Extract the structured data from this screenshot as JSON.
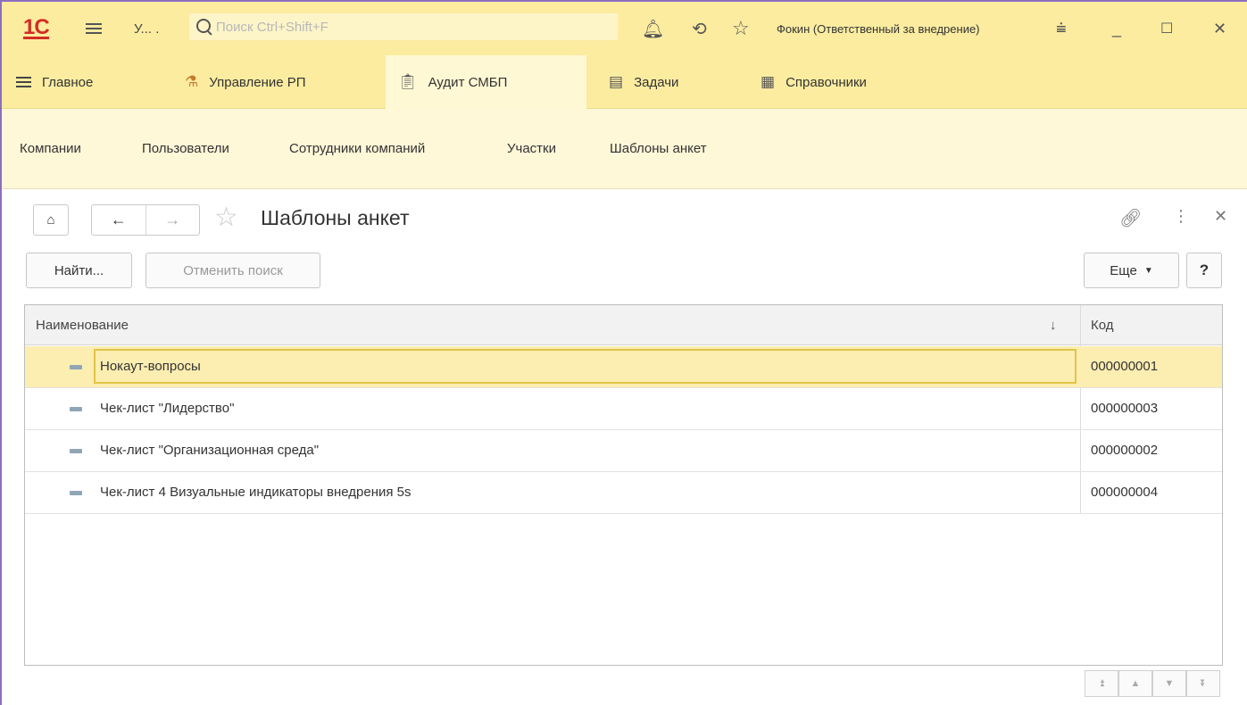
{
  "titlebar": {
    "logo": "1С",
    "app_name": "У... .",
    "search_placeholder": "Поиск Ctrl+Shift+F",
    "user": "Фокин (Ответственный за внедрение)"
  },
  "sections": [
    {
      "label": "Главное",
      "icon": "menu-icon"
    },
    {
      "label": "Управление РП",
      "icon": "workflow-icon"
    },
    {
      "label": "Аудит СМБП",
      "icon": "clipboard-icon",
      "active": true
    },
    {
      "label": "Задачи",
      "icon": "document-icon"
    },
    {
      "label": "Справочники",
      "icon": "table-icon"
    }
  ],
  "functions": [
    "Компании",
    "Пользователи",
    "Сотрудники компаний",
    "Участки",
    "Шаблоны анкет"
  ],
  "form": {
    "title": "Шаблоны анкет"
  },
  "commands": {
    "find": "Найти...",
    "cancel_search": "Отменить поиск",
    "more": "Еще",
    "help": "?"
  },
  "table": {
    "columns": {
      "name": "Наименование",
      "code": "Код"
    },
    "sort_indicator": "↓",
    "rows": [
      {
        "name": "Нокаут-вопросы",
        "code": "000000001",
        "selected": true
      },
      {
        "name": "Чек-лист \"Лидерство\"",
        "code": "000000003"
      },
      {
        "name": "Чек-лист \"Организационная среда\"",
        "code": "000000002"
      },
      {
        "name": "Чек-лист 4 Визуальные индикаторы внедрения 5s",
        "code": "000000004"
      }
    ]
  }
}
